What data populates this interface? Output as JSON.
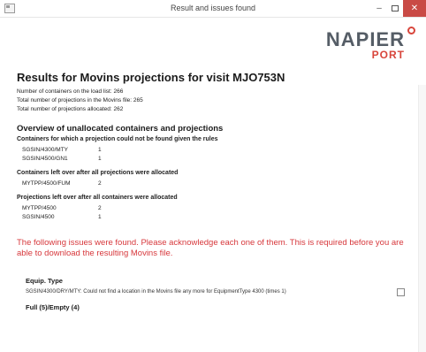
{
  "window": {
    "title": "Result and issues found",
    "minimize_glyph": "–",
    "close_glyph": "✕"
  },
  "logo": {
    "main": "NAPIER",
    "sub": "PORT",
    "ring_color": "#d8453b"
  },
  "colors": {
    "accent": "#d8453b",
    "warning": "#d7383c",
    "close_button": "#c94a45"
  },
  "header": {
    "title": "Results for Movins projections for visit MJO753N",
    "stats": [
      "Number of containers on the load list: 266",
      "Total number of projections in the Movins file: 265",
      "Total number of projections allocated: 262"
    ]
  },
  "overview": {
    "title": "Overview of unallocated containers and projections",
    "groups": [
      {
        "title": "Containers for which a projection could not be found given the rules",
        "rows": [
          {
            "key": "SGSIN/4300/MTY",
            "value": "1"
          },
          {
            "key": "SGSIN/4500/GN1",
            "value": "1"
          }
        ]
      },
      {
        "title": "Containers left over after all projections were allocated",
        "rows": [
          {
            "key": "MYTPP/4500/FUM",
            "value": "2"
          }
        ]
      },
      {
        "title": "Projections left over after all containers were allocated",
        "rows": [
          {
            "key": "MYTPP/4500",
            "value": "2"
          },
          {
            "key": "SGSIN/4500",
            "value": "1"
          }
        ]
      }
    ]
  },
  "warning": "The following issues were found. Please acknowledge each one of them. This is required before you are able to download the resulting Movins file.",
  "issues": [
    {
      "title": "Equip. Type",
      "text": "SGSIN/4300/DRY/MTY: Could not find a location in the Movins file any more for EquipmentType 4300 (times 1)",
      "acknowledged": false
    },
    {
      "title": "Full (5)/Empty (4)"
    }
  ]
}
